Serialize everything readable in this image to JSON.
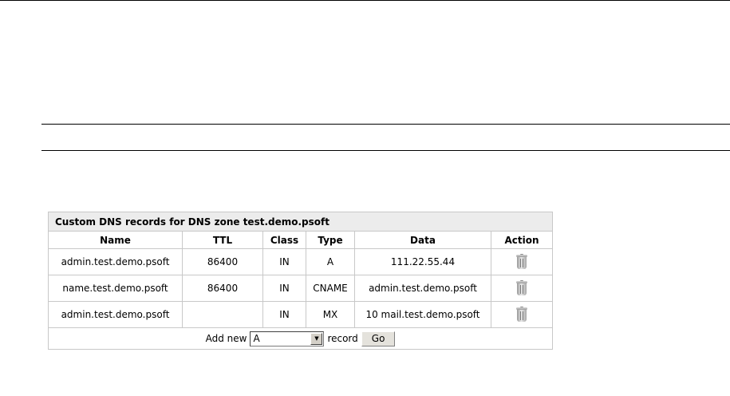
{
  "table": {
    "caption": "Custom DNS records for DNS zone test.demo.psoft",
    "headers": [
      "Name",
      "TTL",
      "Class",
      "Type",
      "Data",
      "Action"
    ],
    "rows": [
      {
        "name": "admin.test.demo.psoft",
        "ttl": "86400",
        "class": "IN",
        "type": "A",
        "data": "111.22.55.44"
      },
      {
        "name": "name.test.demo.psoft",
        "ttl": "86400",
        "class": "IN",
        "type": "CNAME",
        "data": "admin.test.demo.psoft"
      },
      {
        "name": "admin.test.demo.psoft",
        "ttl": "",
        "class": "IN",
        "type": "MX",
        "data": "10 mail.test.demo.psoft"
      }
    ],
    "action_icon": "trash-icon"
  },
  "add_record": {
    "prefix": "Add new",
    "selected_type": "A",
    "suffix": "record",
    "go_label": "Go"
  }
}
